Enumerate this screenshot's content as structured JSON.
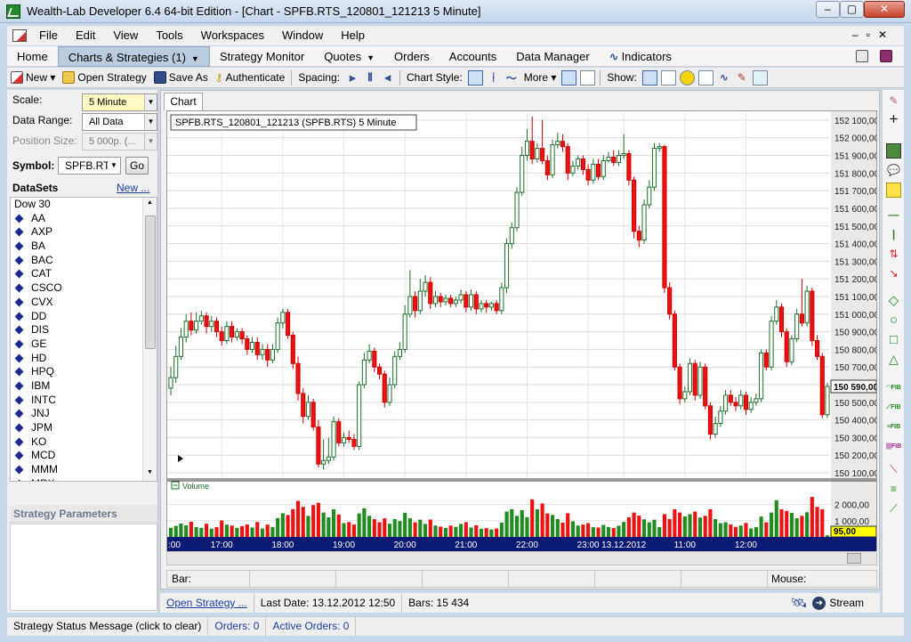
{
  "window": {
    "title": "Wealth-Lab Developer 6.4    64-bit Edition - [Chart - SPFB.RTS_120801_121213 5 Minute]",
    "min": "–",
    "max": "▢",
    "close": "✕"
  },
  "menu": [
    "File",
    "Edit",
    "View",
    "Tools",
    "Workspaces",
    "Window",
    "Help"
  ],
  "tabs": [
    {
      "label": "Home",
      "active": false,
      "caret": false
    },
    {
      "label": "Charts & Strategies (1)",
      "active": true,
      "caret": true
    },
    {
      "label": "Strategy Monitor",
      "active": false,
      "caret": false
    },
    {
      "label": "Quotes",
      "active": false,
      "caret": true
    },
    {
      "label": "Orders",
      "active": false,
      "caret": false
    },
    {
      "label": "Accounts",
      "active": false,
      "caret": false
    },
    {
      "label": "Data Manager",
      "active": false,
      "caret": false
    },
    {
      "label": "Indicators",
      "active": false,
      "caret": false
    }
  ],
  "toolbar": {
    "new": "New",
    "open": "Open Strategy",
    "save": "Save As",
    "auth": "Authenticate",
    "spacing": "Spacing:",
    "chart_style": "Chart Style:",
    "more": "More",
    "show": "Show:"
  },
  "left": {
    "scale_label": "Scale:",
    "scale_value": "5 Minute",
    "range_label": "Data Range:",
    "range_value": "All Data",
    "pos_label": "Position Size:",
    "pos_value": "5 000p. (...",
    "symbol_label": "Symbol:",
    "symbol_value": "SPFB.RTS",
    "go": "Go",
    "datasets": "DataSets",
    "new_link": "New ...",
    "list": [
      "Dow 30",
      "AA",
      "AXP",
      "BA",
      "BAC",
      "CAT",
      "CSCO",
      "CVX",
      "DD",
      "DIS",
      "GE",
      "HD",
      "HPQ",
      "IBM",
      "INTC",
      "JNJ",
      "JPM",
      "KO",
      "MCD",
      "MMM",
      "MRK"
    ],
    "strategy_params": "Strategy Parameters"
  },
  "chart_tab": "Chart",
  "chart_data": {
    "type": "candlestick",
    "title": "SPFB.RTS_120801_121213 (SPFB.RTS) 5 Minute",
    "price_axis": {
      "ylim": [
        150075,
        152140
      ],
      "ticks": [
        "152 100,00",
        "152 000,00",
        "151 900,00",
        "151 800,00",
        "151 700,00",
        "151 600,00",
        "151 500,00",
        "151 400,00",
        "151 300,00",
        "151 200,00",
        "151 100,00",
        "151 000,00",
        "150 900,00",
        "150 800,00",
        "150 700,00",
        "150 600,00",
        "150 500,00",
        "150 400,00",
        "150 300,00",
        "150 200,00",
        "150 100,00"
      ],
      "tick_values": [
        152100,
        152000,
        151900,
        151800,
        151700,
        151600,
        151500,
        151400,
        151300,
        151200,
        151100,
        151000,
        150900,
        150800,
        150700,
        150600,
        150500,
        150400,
        150300,
        150200,
        150100
      ],
      "last_price": "150 590,00",
      "last_price_value": 150590
    },
    "volume_pane": {
      "label": "Volume",
      "ylim": [
        0,
        2850
      ],
      "ticks": [
        "2 000,00",
        "1 000,00"
      ],
      "tick_values": [
        2000,
        1000
      ],
      "last_volume": "95,00",
      "last_volume_value": 95
    },
    "time_axis": {
      "labels": [
        ":00",
        "17:00",
        "18:00",
        "19:00",
        "20:00",
        "21:00",
        "22:00",
        "23:00",
        "13.12.2012",
        "11:00",
        "12:00"
      ],
      "label_bar": [
        0,
        10,
        22,
        34,
        46,
        58,
        70,
        82,
        89,
        101,
        113
      ]
    },
    "up_color": "#22a83a",
    "down_color": "#ee1111",
    "volume_up_color": "#1e8c1e",
    "volume_down_color": "#ee1111",
    "grid": true,
    "bars": [
      {
        "o": 150580,
        "c": 150640,
        "h": 150700,
        "l": 150540,
        "v": 560
      },
      {
        "o": 150640,
        "c": 150760,
        "h": 150820,
        "l": 150610,
        "v": 680
      },
      {
        "o": 150760,
        "c": 150870,
        "h": 150920,
        "l": 150740,
        "v": 830
      },
      {
        "o": 150870,
        "c": 150960,
        "h": 151000,
        "l": 150840,
        "v": 710
      },
      {
        "o": 150960,
        "c": 150910,
        "h": 151010,
        "l": 150880,
        "v": 930
      },
      {
        "o": 150910,
        "c": 150960,
        "h": 151010,
        "l": 150890,
        "v": 610
      },
      {
        "o": 150960,
        "c": 150990,
        "h": 151020,
        "l": 150940,
        "v": 560
      },
      {
        "o": 150990,
        "c": 150930,
        "h": 151010,
        "l": 150890,
        "v": 810
      },
      {
        "o": 150930,
        "c": 150960,
        "h": 150990,
        "l": 150900,
        "v": 510
      },
      {
        "o": 150960,
        "c": 150900,
        "h": 150980,
        "l": 150870,
        "v": 600
      },
      {
        "o": 150900,
        "c": 150850,
        "h": 150930,
        "l": 150820,
        "v": 1010
      },
      {
        "o": 150850,
        "c": 150930,
        "h": 150960,
        "l": 150830,
        "v": 760
      },
      {
        "o": 150930,
        "c": 150870,
        "h": 150960,
        "l": 150840,
        "v": 700
      },
      {
        "o": 150870,
        "c": 150900,
        "h": 150920,
        "l": 150850,
        "v": 560
      },
      {
        "o": 150900,
        "c": 150860,
        "h": 150920,
        "l": 150830,
        "v": 660
      },
      {
        "o": 150860,
        "c": 150800,
        "h": 150880,
        "l": 150770,
        "v": 760
      },
      {
        "o": 150800,
        "c": 150840,
        "h": 150870,
        "l": 150780,
        "v": 580
      },
      {
        "o": 150840,
        "c": 150770,
        "h": 150870,
        "l": 150740,
        "v": 920
      },
      {
        "o": 150770,
        "c": 150800,
        "h": 150830,
        "l": 150740,
        "v": 520
      },
      {
        "o": 150800,
        "c": 150740,
        "h": 150830,
        "l": 150700,
        "v": 760
      },
      {
        "o": 150740,
        "c": 150800,
        "h": 150830,
        "l": 150720,
        "v": 610
      },
      {
        "o": 150800,
        "c": 150950,
        "h": 150980,
        "l": 150780,
        "v": 1160
      },
      {
        "o": 150950,
        "c": 151010,
        "h": 151030,
        "l": 150920,
        "v": 1460
      },
      {
        "o": 151010,
        "c": 150880,
        "h": 151030,
        "l": 150860,
        "v": 1350
      },
      {
        "o": 150880,
        "c": 150720,
        "h": 150900,
        "l": 150690,
        "v": 1710
      },
      {
        "o": 150720,
        "c": 150550,
        "h": 150760,
        "l": 150510,
        "v": 2220
      },
      {
        "o": 150550,
        "c": 150420,
        "h": 150580,
        "l": 150380,
        "v": 1850
      },
      {
        "o": 150420,
        "c": 150500,
        "h": 150540,
        "l": 150400,
        "v": 1300
      },
      {
        "o": 150500,
        "c": 150360,
        "h": 150520,
        "l": 150340,
        "v": 1960
      },
      {
        "o": 150360,
        "c": 150150,
        "h": 150400,
        "l": 150130,
        "v": 2100
      },
      {
        "o": 150150,
        "c": 150170,
        "h": 150290,
        "l": 150120,
        "v": 1500
      },
      {
        "o": 150170,
        "c": 150190,
        "h": 150300,
        "l": 150150,
        "v": 1210
      },
      {
        "o": 150190,
        "c": 150390,
        "h": 150420,
        "l": 150170,
        "v": 1700
      },
      {
        "o": 150390,
        "c": 150270,
        "h": 150410,
        "l": 150250,
        "v": 1380
      },
      {
        "o": 150270,
        "c": 150300,
        "h": 150330,
        "l": 150250,
        "v": 850
      },
      {
        "o": 150300,
        "c": 150290,
        "h": 150340,
        "l": 150270,
        "v": 910
      },
      {
        "o": 150290,
        "c": 150250,
        "h": 150320,
        "l": 150230,
        "v": 760
      },
      {
        "o": 150250,
        "c": 150600,
        "h": 150620,
        "l": 150230,
        "v": 1450
      },
      {
        "o": 150600,
        "c": 150740,
        "h": 150780,
        "l": 150580,
        "v": 1760
      },
      {
        "o": 150740,
        "c": 150790,
        "h": 150830,
        "l": 150720,
        "v": 1300
      },
      {
        "o": 150790,
        "c": 150700,
        "h": 150810,
        "l": 150670,
        "v": 1090
      },
      {
        "o": 150700,
        "c": 150660,
        "h": 150720,
        "l": 150630,
        "v": 900
      },
      {
        "o": 150660,
        "c": 150500,
        "h": 150680,
        "l": 150470,
        "v": 1140
      },
      {
        "o": 150500,
        "c": 150600,
        "h": 150640,
        "l": 150480,
        "v": 810
      },
      {
        "o": 150600,
        "c": 150760,
        "h": 150790,
        "l": 150580,
        "v": 1100
      },
      {
        "o": 150760,
        "c": 150800,
        "h": 150840,
        "l": 150740,
        "v": 980
      },
      {
        "o": 150800,
        "c": 151000,
        "h": 151050,
        "l": 150780,
        "v": 1490
      },
      {
        "o": 151000,
        "c": 151100,
        "h": 151250,
        "l": 150980,
        "v": 1150
      },
      {
        "o": 151100,
        "c": 151020,
        "h": 151130,
        "l": 150980,
        "v": 900
      },
      {
        "o": 151020,
        "c": 151130,
        "h": 151200,
        "l": 151000,
        "v": 1060
      },
      {
        "o": 151130,
        "c": 151180,
        "h": 151220,
        "l": 151100,
        "v": 800
      },
      {
        "o": 151180,
        "c": 151060,
        "h": 151210,
        "l": 151030,
        "v": 1070
      },
      {
        "o": 151060,
        "c": 151100,
        "h": 151130,
        "l": 151040,
        "v": 700
      },
      {
        "o": 151100,
        "c": 151070,
        "h": 151120,
        "l": 151040,
        "v": 630
      },
      {
        "o": 151070,
        "c": 151090,
        "h": 151110,
        "l": 151050,
        "v": 550
      },
      {
        "o": 151090,
        "c": 151060,
        "h": 151110,
        "l": 151040,
        "v": 700
      },
      {
        "o": 151060,
        "c": 151080,
        "h": 151100,
        "l": 151040,
        "v": 620
      },
      {
        "o": 151080,
        "c": 151110,
        "h": 151140,
        "l": 151060,
        "v": 800
      },
      {
        "o": 151110,
        "c": 151040,
        "h": 151130,
        "l": 151010,
        "v": 910
      },
      {
        "o": 151040,
        "c": 151110,
        "h": 151140,
        "l": 151020,
        "v": 580
      },
      {
        "o": 151110,
        "c": 151030,
        "h": 151130,
        "l": 151000,
        "v": 720
      },
      {
        "o": 151030,
        "c": 151060,
        "h": 151080,
        "l": 151010,
        "v": 500
      },
      {
        "o": 151060,
        "c": 151040,
        "h": 151080,
        "l": 151010,
        "v": 540
      },
      {
        "o": 151040,
        "c": 151060,
        "h": 151070,
        "l": 151020,
        "v": 460
      },
      {
        "o": 151060,
        "c": 151020,
        "h": 151080,
        "l": 151000,
        "v": 520
      },
      {
        "o": 151020,
        "c": 151150,
        "h": 151180,
        "l": 151000,
        "v": 880
      },
      {
        "o": 151150,
        "c": 151400,
        "h": 151430,
        "l": 151120,
        "v": 1560
      },
      {
        "o": 151400,
        "c": 151490,
        "h": 151520,
        "l": 151370,
        "v": 1710
      },
      {
        "o": 151490,
        "c": 151690,
        "h": 151720,
        "l": 151470,
        "v": 1300
      },
      {
        "o": 151690,
        "c": 151900,
        "h": 151950,
        "l": 151670,
        "v": 1650
      },
      {
        "o": 151900,
        "c": 151980,
        "h": 152050,
        "l": 151870,
        "v": 1210
      },
      {
        "o": 151980,
        "c": 151880,
        "h": 152120,
        "l": 151850,
        "v": 2310
      },
      {
        "o": 151880,
        "c": 151940,
        "h": 151970,
        "l": 151860,
        "v": 1700
      },
      {
        "o": 151940,
        "c": 151870,
        "h": 152100,
        "l": 151850,
        "v": 2060
      },
      {
        "o": 151870,
        "c": 151790,
        "h": 151900,
        "l": 151760,
        "v": 1450
      },
      {
        "o": 151790,
        "c": 151960,
        "h": 151990,
        "l": 151770,
        "v": 1350
      },
      {
        "o": 151960,
        "c": 151980,
        "h": 152030,
        "l": 151940,
        "v": 1100
      },
      {
        "o": 151980,
        "c": 151950,
        "h": 152020,
        "l": 151920,
        "v": 880
      },
      {
        "o": 151950,
        "c": 151800,
        "h": 151970,
        "l": 151760,
        "v": 1460
      },
      {
        "o": 151800,
        "c": 151840,
        "h": 151870,
        "l": 151780,
        "v": 960
      },
      {
        "o": 151840,
        "c": 151880,
        "h": 151900,
        "l": 151820,
        "v": 700
      },
      {
        "o": 151880,
        "c": 151820,
        "h": 151900,
        "l": 151790,
        "v": 760
      },
      {
        "o": 151820,
        "c": 151760,
        "h": 151850,
        "l": 151730,
        "v": 850
      },
      {
        "o": 151760,
        "c": 151850,
        "h": 151880,
        "l": 151740,
        "v": 600
      },
      {
        "o": 151850,
        "c": 151780,
        "h": 151880,
        "l": 151760,
        "v": 580
      },
      {
        "o": 151780,
        "c": 151870,
        "h": 151900,
        "l": 151760,
        "v": 740
      },
      {
        "o": 151870,
        "c": 151890,
        "h": 151920,
        "l": 151860,
        "v": 610
      },
      {
        "o": 151890,
        "c": 151860,
        "h": 151930,
        "l": 151840,
        "v": 550
      },
      {
        "o": 151860,
        "c": 151900,
        "h": 151930,
        "l": 151840,
        "v": 690
      },
      {
        "o": 151900,
        "c": 151910,
        "h": 152020,
        "l": 151880,
        "v": 920
      },
      {
        "o": 151910,
        "c": 151760,
        "h": 151930,
        "l": 151730,
        "v": 1210
      },
      {
        "o": 151760,
        "c": 151470,
        "h": 151780,
        "l": 151430,
        "v": 1500
      },
      {
        "o": 151470,
        "c": 151420,
        "h": 151500,
        "l": 151380,
        "v": 1310
      },
      {
        "o": 151420,
        "c": 151620,
        "h": 151650,
        "l": 151400,
        "v": 1080
      },
      {
        "o": 151620,
        "c": 151720,
        "h": 151760,
        "l": 151600,
        "v": 900
      },
      {
        "o": 151720,
        "c": 151940,
        "h": 151970,
        "l": 151700,
        "v": 1060
      },
      {
        "o": 151940,
        "c": 151950,
        "h": 151970,
        "l": 151920,
        "v": 600
      },
      {
        "o": 151950,
        "c": 151150,
        "h": 151960,
        "l": 151120,
        "v": 1400
      },
      {
        "o": 151150,
        "c": 151000,
        "h": 151180,
        "l": 150970,
        "v": 1100
      },
      {
        "o": 151000,
        "c": 150700,
        "h": 151020,
        "l": 150680,
        "v": 1700
      },
      {
        "o": 150700,
        "c": 150520,
        "h": 150720,
        "l": 150490,
        "v": 1500
      },
      {
        "o": 150520,
        "c": 150560,
        "h": 150590,
        "l": 150500,
        "v": 1260
      },
      {
        "o": 150560,
        "c": 150720,
        "h": 150750,
        "l": 150540,
        "v": 1400
      },
      {
        "o": 150720,
        "c": 150540,
        "h": 150740,
        "l": 150510,
        "v": 1560
      },
      {
        "o": 150540,
        "c": 150700,
        "h": 150730,
        "l": 150520,
        "v": 1190
      },
      {
        "o": 150700,
        "c": 150480,
        "h": 150720,
        "l": 150460,
        "v": 1300
      },
      {
        "o": 150480,
        "c": 150320,
        "h": 150500,
        "l": 150290,
        "v": 1700
      },
      {
        "o": 150320,
        "c": 150380,
        "h": 150420,
        "l": 150300,
        "v": 1100
      },
      {
        "o": 150380,
        "c": 150450,
        "h": 150480,
        "l": 150360,
        "v": 850
      },
      {
        "o": 150450,
        "c": 150540,
        "h": 150570,
        "l": 150430,
        "v": 900
      },
      {
        "o": 150540,
        "c": 150500,
        "h": 150570,
        "l": 150480,
        "v": 760
      },
      {
        "o": 150500,
        "c": 150480,
        "h": 150530,
        "l": 150450,
        "v": 620
      },
      {
        "o": 150480,
        "c": 150540,
        "h": 150570,
        "l": 150460,
        "v": 700
      },
      {
        "o": 150540,
        "c": 150460,
        "h": 150560,
        "l": 150430,
        "v": 860
      },
      {
        "o": 150460,
        "c": 150500,
        "h": 150530,
        "l": 150440,
        "v": 520
      },
      {
        "o": 150500,
        "c": 150520,
        "h": 150550,
        "l": 150480,
        "v": 600
      },
      {
        "o": 150520,
        "c": 150780,
        "h": 150800,
        "l": 150500,
        "v": 1250
      },
      {
        "o": 150780,
        "c": 150700,
        "h": 150800,
        "l": 150680,
        "v": 900
      },
      {
        "o": 150700,
        "c": 150960,
        "h": 150990,
        "l": 150680,
        "v": 1500
      },
      {
        "o": 150960,
        "c": 151040,
        "h": 151080,
        "l": 150940,
        "v": 2260
      },
      {
        "o": 151040,
        "c": 150900,
        "h": 151060,
        "l": 150870,
        "v": 1700
      },
      {
        "o": 150900,
        "c": 150730,
        "h": 150920,
        "l": 150700,
        "v": 1600
      },
      {
        "o": 150730,
        "c": 150860,
        "h": 150880,
        "l": 150710,
        "v": 1480
      },
      {
        "o": 150860,
        "c": 151000,
        "h": 151030,
        "l": 150840,
        "v": 1150
      },
      {
        "o": 151000,
        "c": 150950,
        "h": 151200,
        "l": 150930,
        "v": 1300
      },
      {
        "o": 150950,
        "c": 151130,
        "h": 151160,
        "l": 150930,
        "v": 1520
      },
      {
        "o": 151130,
        "c": 150850,
        "h": 151150,
        "l": 150820,
        "v": 2460
      },
      {
        "o": 150850,
        "c": 150760,
        "h": 150880,
        "l": 150740,
        "v": 1850
      },
      {
        "o": 150760,
        "c": 150430,
        "h": 150780,
        "l": 150410,
        "v": 1700
      },
      {
        "o": 150430,
        "c": 150590,
        "h": 150610,
        "l": 150410,
        "v": 95
      }
    ]
  },
  "status_row": {
    "bar": "Bar:",
    "mouse": "Mouse:"
  },
  "strategy_row": {
    "open": "Open Strategy ...",
    "last_date": "Last Date: 13.12.2012 12:50",
    "bars": "Bars: 15 434",
    "stream": "Stream"
  },
  "statusbar": {
    "message": "Strategy Status Message (click to clear)",
    "orders": "Orders: 0",
    "active_orders": "Active Orders: 0"
  }
}
